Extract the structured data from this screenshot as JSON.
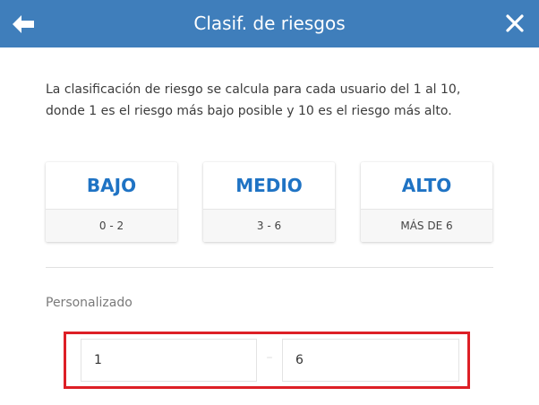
{
  "header": {
    "title": "Clasif. de riesgos",
    "back_icon": "arrow-left-icon",
    "close_icon": "close-icon",
    "background_color": "#3f7ebb"
  },
  "description": "La clasificación de riesgo se calcula para cada usuario del 1 al 10,\ndonde 1 es el riesgo más bajo posible y 10 es el riesgo más alto.",
  "levels": [
    {
      "label": "BAJO",
      "range": "0 - 2"
    },
    {
      "label": "MEDIO",
      "range": "3 - 6"
    },
    {
      "label": "ALTO",
      "range": "MÁS DE 6"
    }
  ],
  "custom": {
    "label": "Personalizado",
    "min_value": "1",
    "separator": "–",
    "max_value": "6"
  },
  "colors": {
    "accent": "#1f73c4",
    "highlight_border": "#dd1f26"
  }
}
